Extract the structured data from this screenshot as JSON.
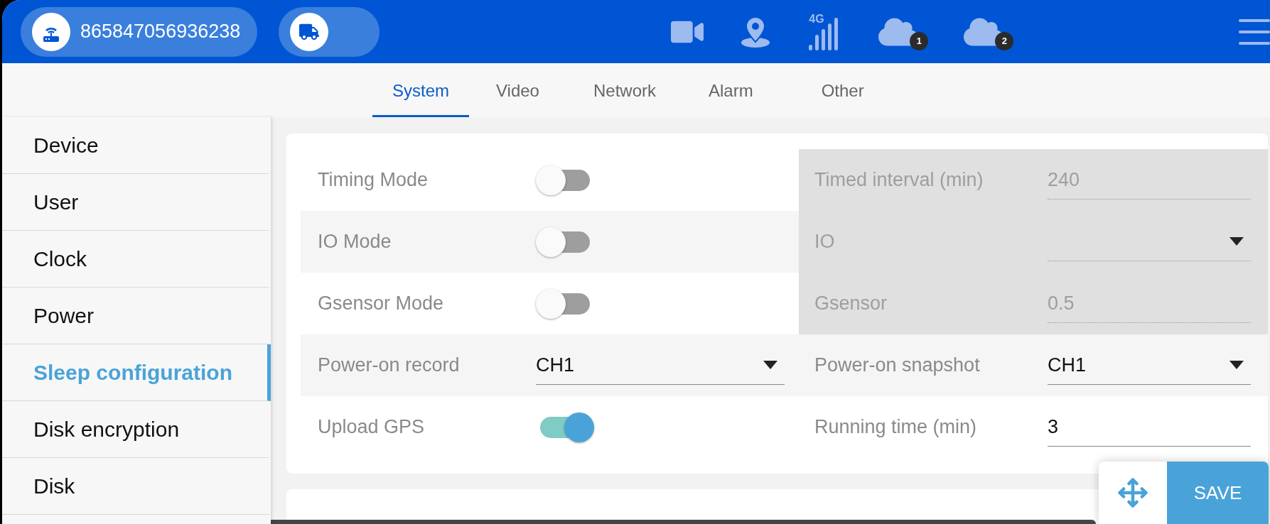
{
  "header": {
    "device_id": "865847056936238",
    "network": "4G",
    "clouds": [
      {
        "badge": "1"
      },
      {
        "badge": "2"
      }
    ]
  },
  "tabs": [
    {
      "label": "System",
      "selected": true
    },
    {
      "label": "Video",
      "selected": false
    },
    {
      "label": "Network",
      "selected": false
    },
    {
      "label": "Alarm",
      "selected": false
    },
    {
      "label": "Other",
      "selected": false
    }
  ],
  "sidebar": {
    "items": [
      {
        "label": "Device",
        "selected": false
      },
      {
        "label": "User",
        "selected": false
      },
      {
        "label": "Clock",
        "selected": false
      },
      {
        "label": "Power",
        "selected": false
      },
      {
        "label": "Sleep configuration",
        "selected": true
      },
      {
        "label": "Disk encryption",
        "selected": false
      },
      {
        "label": "Disk",
        "selected": false
      }
    ]
  },
  "settings": [
    {
      "left": {
        "label": "Timing Mode",
        "kind": "switch",
        "on": false
      },
      "right": {
        "label": "Timed interval (min)",
        "kind": "text",
        "value": "240",
        "disabled": true
      }
    },
    {
      "left": {
        "label": "IO Mode",
        "kind": "switch",
        "on": false
      },
      "right": {
        "label": "IO",
        "kind": "select",
        "disabled": true
      }
    },
    {
      "left": {
        "label": "Gsensor Mode",
        "kind": "switch",
        "on": false
      },
      "right": {
        "label": "Gsensor",
        "kind": "text",
        "value": "0.5",
        "disabled": true
      }
    },
    {
      "left": {
        "label": "Power-on record",
        "kind": "select",
        "value": "CH1"
      },
      "right": {
        "label": "Power-on snapshot",
        "kind": "select",
        "value": "CH1",
        "disabled": false
      }
    },
    {
      "left": {
        "label": "Upload GPS",
        "kind": "switch",
        "on": true
      },
      "right": {
        "label": "Running time (min)",
        "kind": "text",
        "value": "3",
        "disabled": false
      }
    }
  ],
  "save_button": "SAVE"
}
